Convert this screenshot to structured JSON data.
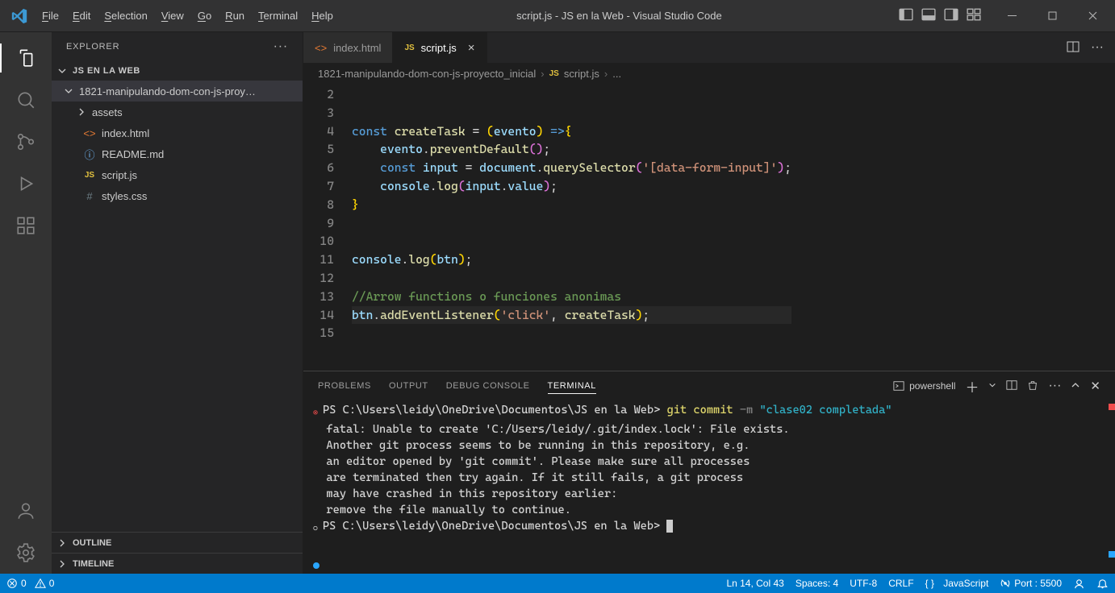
{
  "window": {
    "title": "script.js - JS en la Web - Visual Studio Code"
  },
  "menubar": [
    "File",
    "Edit",
    "Selection",
    "View",
    "Go",
    "Run",
    "Terminal",
    "Help"
  ],
  "activitybar": {
    "top": [
      "explorer",
      "search",
      "scm",
      "run-debug",
      "extensions"
    ],
    "bottom": [
      "account",
      "settings"
    ],
    "active": "explorer"
  },
  "explorer": {
    "title": "EXPLORER",
    "project": "JS EN LA WEB",
    "rootFolder": "1821-manipulando-dom-con-js-proy…",
    "entries": [
      {
        "type": "folder",
        "name": "assets"
      },
      {
        "type": "file",
        "name": "index.html",
        "icon": "html"
      },
      {
        "type": "file",
        "name": "README.md",
        "icon": "info"
      },
      {
        "type": "file",
        "name": "script.js",
        "icon": "js"
      },
      {
        "type": "file",
        "name": "styles.css",
        "icon": "hash"
      }
    ],
    "outline": "OUTLINE",
    "timeline": "TIMELINE"
  },
  "tabs": [
    {
      "label": "index.html",
      "icon": "html",
      "active": false
    },
    {
      "label": "script.js",
      "icon": "js",
      "active": true
    }
  ],
  "breadcrumbs": {
    "path": "1821-manipulando-dom-con-js-proyecto_inicial",
    "file": "script.js",
    "tail": "..."
  },
  "editor": {
    "startLine": 2,
    "currentLine": 14,
    "lines": [
      {
        "n": 2,
        "t": ""
      },
      {
        "n": 3,
        "t": ""
      },
      {
        "n": 4,
        "tokens": [
          [
            "kw",
            "const"
          ],
          [
            "wht",
            " "
          ],
          [
            "fn",
            "createTask"
          ],
          [
            "wht",
            " "
          ],
          [
            "op",
            "="
          ],
          [
            "wht",
            " "
          ],
          [
            "p-y",
            "("
          ],
          [
            "var",
            "evento"
          ],
          [
            "p-y",
            ")"
          ],
          [
            "wht",
            " "
          ],
          [
            "kw",
            "=>"
          ],
          [
            "p-y",
            "{"
          ]
        ]
      },
      {
        "n": 5,
        "tokens": [
          [
            "wht",
            "    "
          ],
          [
            "var",
            "evento"
          ],
          [
            "wht",
            "."
          ],
          [
            "fn",
            "preventDefault"
          ],
          [
            "p-p",
            "("
          ],
          [
            "p-p",
            ")"
          ],
          [
            "wht",
            ";"
          ]
        ]
      },
      {
        "n": 6,
        "tokens": [
          [
            "wht",
            "    "
          ],
          [
            "kw",
            "const"
          ],
          [
            "wht",
            " "
          ],
          [
            "var",
            "input"
          ],
          [
            "wht",
            " "
          ],
          [
            "op",
            "="
          ],
          [
            "wht",
            " "
          ],
          [
            "var",
            "document"
          ],
          [
            "wht",
            "."
          ],
          [
            "fn",
            "querySelector"
          ],
          [
            "p-p",
            "("
          ],
          [
            "str",
            "'[data-form-input]'"
          ],
          [
            "p-p",
            ")"
          ],
          [
            "wht",
            ";"
          ]
        ]
      },
      {
        "n": 7,
        "tokens": [
          [
            "wht",
            "    "
          ],
          [
            "var",
            "console"
          ],
          [
            "wht",
            "."
          ],
          [
            "fn",
            "log"
          ],
          [
            "p-p",
            "("
          ],
          [
            "var",
            "input"
          ],
          [
            "wht",
            "."
          ],
          [
            "var",
            "value"
          ],
          [
            "p-p",
            ")"
          ],
          [
            "wht",
            ";"
          ]
        ]
      },
      {
        "n": 8,
        "tokens": [
          [
            "p-y",
            "}"
          ]
        ]
      },
      {
        "n": 9,
        "t": ""
      },
      {
        "n": 10,
        "t": ""
      },
      {
        "n": 11,
        "tokens": [
          [
            "var",
            "console"
          ],
          [
            "wht",
            "."
          ],
          [
            "fn",
            "log"
          ],
          [
            "p-y",
            "("
          ],
          [
            "var",
            "btn"
          ],
          [
            "p-y",
            ")"
          ],
          [
            "wht",
            ";"
          ]
        ]
      },
      {
        "n": 12,
        "t": ""
      },
      {
        "n": 13,
        "tokens": [
          [
            "cmt",
            "//Arrow functions o funciones anonimas"
          ]
        ]
      },
      {
        "n": 14,
        "tokens": [
          [
            "var",
            "btn"
          ],
          [
            "wht",
            "."
          ],
          [
            "fn",
            "addEventListener"
          ],
          [
            "p-y",
            "("
          ],
          [
            "str",
            "'click'"
          ],
          [
            "wht",
            ", "
          ],
          [
            "fn",
            "createTask"
          ],
          [
            "p-y",
            ")"
          ],
          [
            "wht",
            ";"
          ]
        ]
      },
      {
        "n": 15,
        "t": ""
      }
    ]
  },
  "panel": {
    "tabs": [
      "PROBLEMS",
      "OUTPUT",
      "DEBUG CONSOLE",
      "TERMINAL"
    ],
    "active": "TERMINAL",
    "shell_label": "powershell",
    "body_tokens": [
      [
        [
          "marker",
          "⊗"
        ],
        [
          "wht",
          "PS C:\\Users\\leidy\\OneDrive\\Documentos\\JS en la Web> "
        ],
        [
          "t-yel",
          "git "
        ],
        [
          "t-yel",
          "commit "
        ],
        [
          "t-gray",
          "-m "
        ],
        [
          "t-cyan",
          "\"clase02 completada\""
        ]
      ],
      [
        [
          "wht",
          "  fatal: Unable to create 'C:/Users/leidy/.git/index.lock': File exists."
        ]
      ],
      [
        [
          "wht",
          ""
        ]
      ],
      [
        [
          "wht",
          "  Another git process seems to be running in this repository, e.g."
        ]
      ],
      [
        [
          "wht",
          "  an editor opened by 'git commit'. Please make sure all processes"
        ]
      ],
      [
        [
          "wht",
          "  are terminated then try again. If it still fails, a git process"
        ]
      ],
      [
        [
          "wht",
          "  may have crashed in this repository earlier:"
        ]
      ],
      [
        [
          "wht",
          "  remove the file manually to continue."
        ]
      ],
      [
        [
          "marker-ok",
          "○"
        ],
        [
          "wht",
          "PS C:\\Users\\leidy\\OneDrive\\Documentos\\JS en la Web> "
        ],
        [
          "cursor",
          ""
        ]
      ]
    ]
  },
  "statusbar": {
    "errors": "0",
    "warnings": "0",
    "cursor": "Ln 14, Col 43",
    "spaces": "Spaces: 4",
    "encoding": "UTF-8",
    "eol": "CRLF",
    "lang": "JavaScript",
    "port": "Port : 5500"
  }
}
